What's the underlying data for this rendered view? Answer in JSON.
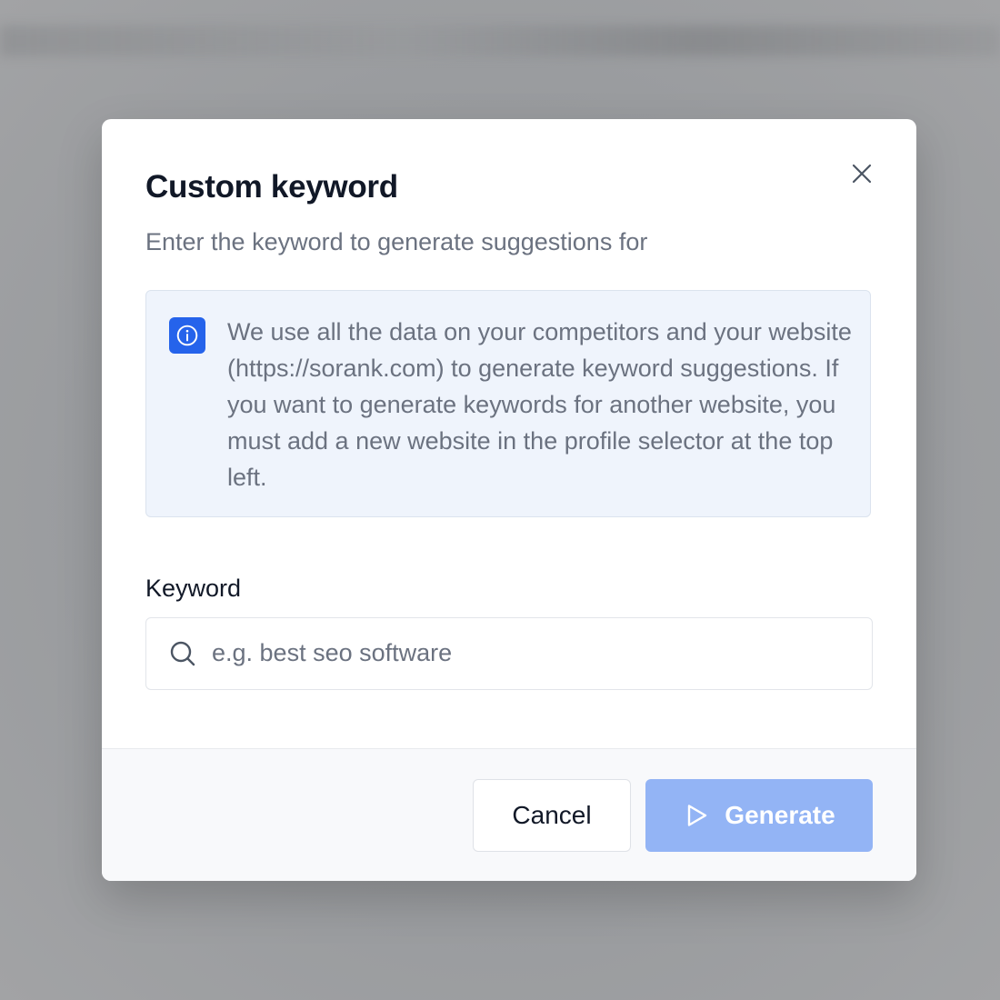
{
  "modal": {
    "title": "Custom keyword",
    "subtitle": "Enter the keyword to generate suggestions for",
    "info_text": "We use all the data on your competitors and your website (https://sorank.com) to generate keyword suggestions. If you want to generate keywords for another website, you must add a new website in the profile selector at the top left.",
    "keyword_label": "Keyword",
    "keyword_input": {
      "value": "",
      "placeholder": "e.g. best seo software"
    },
    "cancel_label": "Cancel",
    "generate_label": "Generate",
    "generate_disabled": true
  },
  "icons": {
    "close": "close-icon",
    "info": "info-icon",
    "search": "search-icon",
    "play": "play-icon"
  },
  "colors": {
    "accent": "#2563eb",
    "generate_disabled_bg": "#93b4f5",
    "info_bg": "#eff4fc"
  }
}
